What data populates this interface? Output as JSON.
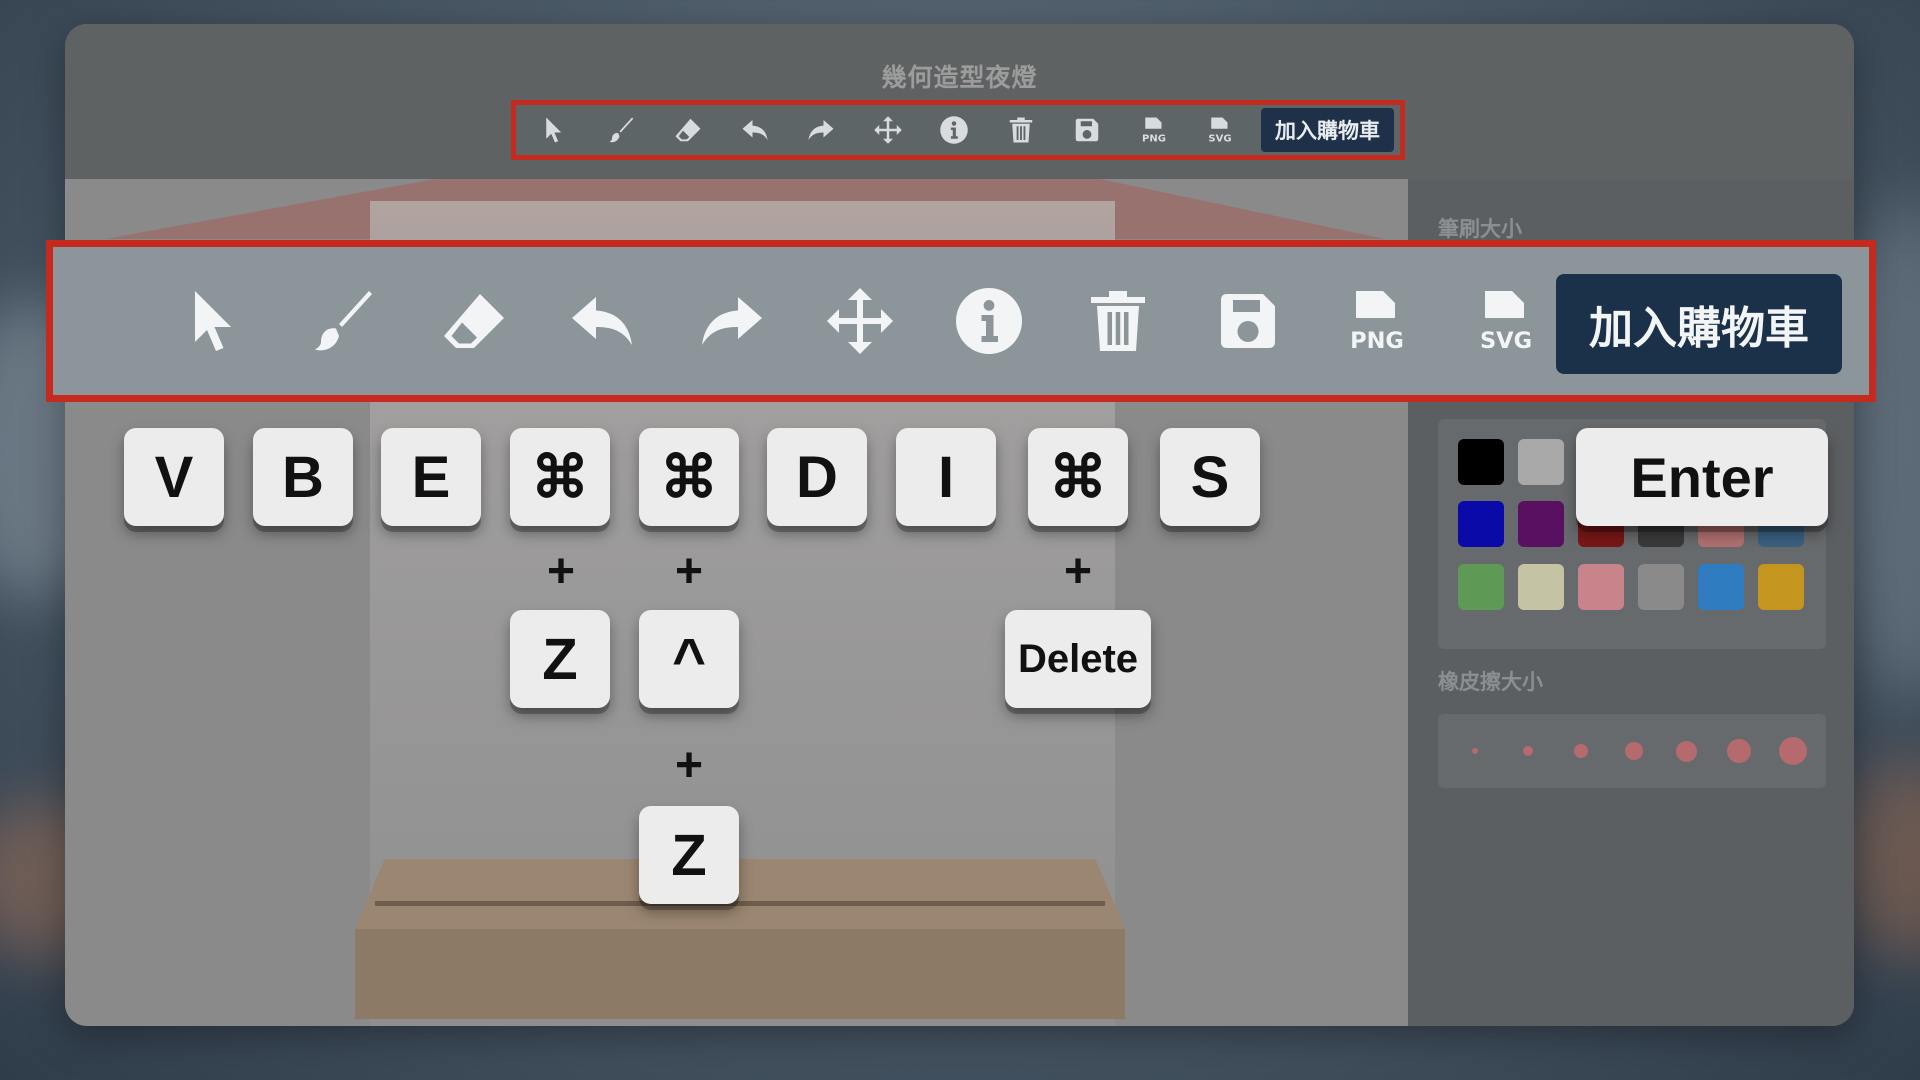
{
  "app": {
    "title": "幾何造型夜燈"
  },
  "toolbar": {
    "tools": [
      {
        "id": "select",
        "icon": "cursor-arrow-icon"
      },
      {
        "id": "brush",
        "icon": "paintbrush-icon"
      },
      {
        "id": "eraser",
        "icon": "eraser-icon"
      },
      {
        "id": "undo",
        "icon": "undo-arrow-icon"
      },
      {
        "id": "redo",
        "icon": "redo-arrow-icon"
      },
      {
        "id": "move",
        "icon": "move-arrows-icon"
      },
      {
        "id": "info",
        "icon": "info-circle-icon"
      },
      {
        "id": "delete",
        "icon": "trash-icon"
      },
      {
        "id": "save",
        "icon": "floppy-save-icon"
      },
      {
        "id": "export_png",
        "icon": "png-file-icon",
        "text": "PNG"
      },
      {
        "id": "export_svg",
        "icon": "svg-file-icon",
        "text": "SVG"
      }
    ],
    "cart_label": "加入購物車"
  },
  "panel": {
    "brush_size_label": "筆刷大小",
    "eraser_size_label": "橡皮擦大小",
    "colors": [
      "#000000",
      "#a9a9a9",
      "#0a0aa8",
      "#5a1060",
      "#7a1616",
      "#3a3a3a",
      "#b07070",
      "#3a6080",
      "#5e9a56",
      "#c4c4a4",
      "#c8848a",
      "#8a8a8a",
      "#2f7cc0",
      "#c49620"
    ]
  },
  "shortcuts": {
    "select": {
      "keys": [
        "V"
      ]
    },
    "brush": {
      "keys": [
        "B"
      ]
    },
    "eraser": {
      "keys": [
        "E"
      ]
    },
    "undo": {
      "keys": [
        "⌘",
        "Z"
      ]
    },
    "redo": {
      "keys": [
        "⌘",
        "^",
        "Z"
      ]
    },
    "move": {
      "keys": [
        "D"
      ]
    },
    "info": {
      "keys": [
        "I"
      ]
    },
    "delete": {
      "keys": [
        "⌘",
        "Delete"
      ]
    },
    "save": {
      "keys": [
        "S"
      ]
    },
    "cart": {
      "keys": [
        "Enter"
      ]
    },
    "plus": "+"
  },
  "colors": {
    "highlight_border": "#c42b1e",
    "cart_bg": "#1b3149",
    "key_face": "#ececec"
  }
}
